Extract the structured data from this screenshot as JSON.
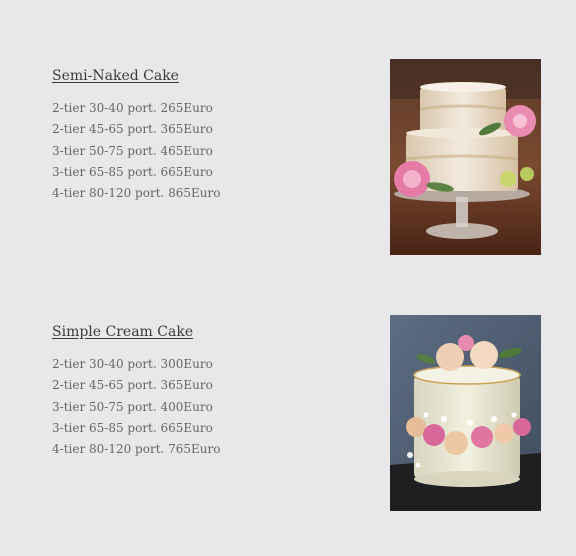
{
  "products": [
    {
      "title": "Semi-Naked Cake",
      "prices": [
        "2-tier 30-40 port. 265Euro",
        "2-tier 45-65 port. 365Euro",
        "3-tier 50-75 port. 465Euro",
        "3-tier 65-85 port. 665Euro",
        "4-tier 80-120 port. 865Euro"
      ]
    },
    {
      "title": "Simple Cream Cake",
      "prices": [
        "2-tier 30-40 port. 300Euro",
        "2-tier 45-65 port. 365Euro",
        "3-tier 50-75 port. 400Euro",
        "3-tier 65-85 port. 665Euro",
        "4-tier 80-120 port. 765Euro"
      ]
    }
  ]
}
